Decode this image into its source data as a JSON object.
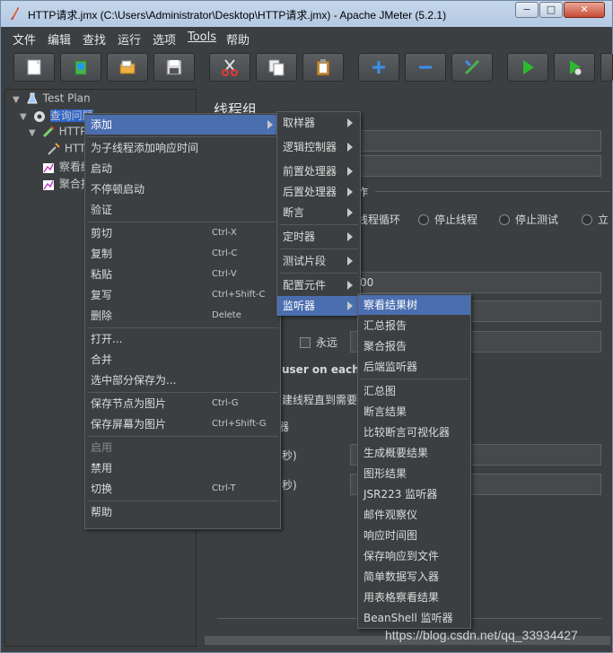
{
  "window": {
    "title": "HTTP请求.jmx (C:\\Users\\Administrator\\Desktop\\HTTP请求.jmx) - Apache JMeter (5.2.1)",
    "controls": {
      "minimize": "−",
      "maximize": "□",
      "close": "✕"
    }
  },
  "menubar": {
    "items": [
      "文件",
      "编辑",
      "查找",
      "运行",
      "选项",
      "Tools",
      "帮助"
    ]
  },
  "toolbar": {
    "icons": [
      "new-icon",
      "templates-icon",
      "open-icon",
      "save-icon",
      "cut-icon",
      "copy-icon",
      "paste-icon",
      "expand-icon",
      "collapse-icon",
      "toggle-icon",
      "start-icon",
      "start-no-pause-icon"
    ]
  },
  "tree": {
    "items": [
      {
        "label": "Test Plan",
        "icon": "test-plan-icon"
      },
      {
        "label": "查询问题",
        "icon": "thread-group-icon"
      },
      {
        "label": "HTTP",
        "icon": "http-sampler-icon"
      },
      {
        "label": "HTT",
        "icon": "tool-icon"
      },
      {
        "label": "察看结",
        "icon": "listener-icon"
      },
      {
        "label": "聚合报",
        "icon": "listener-icon"
      }
    ]
  },
  "right_panel": {
    "title": "线程组",
    "section_label": "作",
    "radio_options": [
      "线程循环",
      "停止线程",
      "停止测试",
      "立"
    ],
    "field_value": "00",
    "forever_label": "永远",
    "same_user_label": "user on each it",
    "delay_label": "建线程直到需要",
    "scheduler_label": "器",
    "duration_label": "秒)",
    "startup_delay_label": "秒)"
  },
  "context_menu": {
    "items": [
      {
        "label": "添加",
        "submenu": true
      },
      {
        "separator": true
      },
      {
        "label": "为子线程添加响应时间"
      },
      {
        "label": "启动"
      },
      {
        "label": "不停顿启动"
      },
      {
        "label": "验证"
      },
      {
        "separator": true
      },
      {
        "label": "剪切",
        "accel": "Ctrl-X"
      },
      {
        "label": "复制",
        "accel": "Ctrl-C"
      },
      {
        "label": "粘贴",
        "accel": "Ctrl-V"
      },
      {
        "label": "复写",
        "accel": "Ctrl+Shift-C"
      },
      {
        "label": "删除",
        "accel": "Delete"
      },
      {
        "separator": true
      },
      {
        "label": "打开..."
      },
      {
        "label": "合并"
      },
      {
        "label": "选中部分保存为..."
      },
      {
        "separator": true
      },
      {
        "label": "保存节点为图片",
        "accel": "Ctrl-G"
      },
      {
        "label": "保存屏幕为图片",
        "accel": "Ctrl+Shift-G"
      },
      {
        "separator": true
      },
      {
        "label": "启用",
        "disabled": true
      },
      {
        "label": "禁用"
      },
      {
        "label": "切换",
        "accel": "Ctrl-T"
      },
      {
        "separator": true
      },
      {
        "label": "帮助"
      }
    ]
  },
  "add_submenu": {
    "items": [
      "取样器",
      "逻辑控制器",
      "前置处理器",
      "后置处理器",
      "断言",
      "定时器",
      "测试片段",
      "配置元件",
      "监听器"
    ]
  },
  "listener_submenu": {
    "items": [
      "察看结果树",
      "汇总报告",
      "聚合报告",
      "后端监听器",
      "汇总图",
      "断言结果",
      "比较断言可视化器",
      "生成概要结果",
      "图形结果",
      "JSR223 监听器",
      "邮件观察仪",
      "响应时间图",
      "保存响应到文件",
      "简单数据写入器",
      "用表格察看结果",
      "BeanShell 监听器"
    ]
  },
  "watermark": "https://blog.csdn.net/qq_33934427"
}
